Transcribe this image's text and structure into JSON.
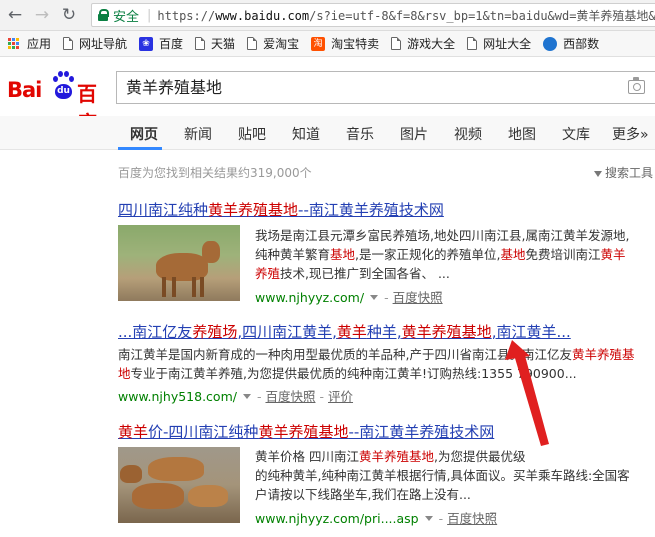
{
  "browser": {
    "secure_label": "安全",
    "url_prefix": "https://",
    "url_host": "www.baidu.com",
    "url_rest": "/s?ie=utf-8&f=8&rsv_bp=1&tn=baidu&wd=黄羊养殖基地&"
  },
  "bookmarks": [
    {
      "label": "应用",
      "icon": "apps-icon"
    },
    {
      "label": "网址导航",
      "icon": "page-icon"
    },
    {
      "label": "百度",
      "icon": "baidu-paw-icon"
    },
    {
      "label": "天猫",
      "icon": "page-icon"
    },
    {
      "label": "爱淘宝",
      "icon": "page-icon"
    },
    {
      "label": "淘宝特卖",
      "icon": "taobao-icon"
    },
    {
      "label": "游戏大全",
      "icon": "page-icon"
    },
    {
      "label": "网址大全",
      "icon": "page-icon"
    },
    {
      "label": "西部数",
      "icon": "xibu-icon"
    }
  ],
  "logo": {
    "bai": "Bai",
    "du": "du",
    "cn": "百度"
  },
  "search": {
    "query": "黄羊养殖基地"
  },
  "tabs": [
    "网页",
    "新闻",
    "贴吧",
    "知道",
    "音乐",
    "图片",
    "视频",
    "地图",
    "文库",
    "更多»"
  ],
  "summary": "百度为您找到相关结果约319,000个",
  "tools_label": "搜索工具",
  "results": [
    {
      "title": [
        "四川南江纯种",
        "黄羊养殖基地",
        "--南江黄羊养殖技术网"
      ],
      "lines": [
        [
          "我场是南江县元潭乡富民养殖场,地处四川南江县,属南江黄羊发源地,"
        ],
        [
          "纯种黄羊繁育",
          "基地",
          ",是一家正规化的养殖单位,",
          "基地",
          "免费培训南江",
          "黄羊"
        ],
        [
          "养殖",
          "技术,现已推广到全国各省、 ..."
        ]
      ],
      "url": "www.njhyyz.com/",
      "snapshot": "百度快照"
    },
    {
      "title": [
        "...南江亿友",
        "养殖场",
        ",四川南江黄羊,",
        "黄羊",
        "种羊,",
        "黄羊养殖基地",
        ",南江黄羊..."
      ],
      "lines": [
        [
          "南江黄羊是国内新育成的一种肉用型最优质的羊品种,产于四川省南江县。南江亿友",
          "黄羊养殖基"
        ],
        [
          "地",
          "专业于南江黄羊养殖,为您提供最优质的纯种南江黄羊!订购热线:1355 790900..."
        ]
      ],
      "url": "www.njhy518.com/",
      "snapshot": "百度快照",
      "rating": "评价"
    },
    {
      "title": [
        "黄羊",
        "价-四川南江纯种",
        "黄羊养殖基地",
        "--南江黄羊养殖技术网"
      ],
      "lines": [
        [
          "黄羊价格 四川南江",
          "黄羊养殖基地",
          ",为您提供最优级"
        ],
        [
          "的纯种黄羊,纯种南江黄羊根据行情,具体面议。买羊乘车路线:全国客"
        ],
        [
          "户请按以下线路坐车,我们在路上没有..."
        ]
      ],
      "url": "www.njhyyz.com/pri....asp",
      "snapshot": "百度快照"
    }
  ],
  "colors": {
    "link": "#2440b3",
    "highlight": "#cc0000",
    "url_green": "#008000",
    "annotation_arrow": "#e02020",
    "baidu_red": "#e10601",
    "baidu_blue": "#2319dc"
  }
}
